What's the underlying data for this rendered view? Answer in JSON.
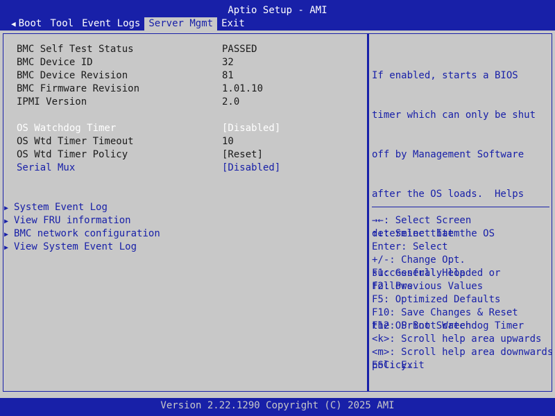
{
  "header": {
    "title": "Aptio Setup - AMI",
    "tabs": [
      {
        "label": "Boot",
        "has_arrow": true
      },
      {
        "label": "Tool"
      },
      {
        "label": "Event Logs"
      },
      {
        "label": "Server Mgmt",
        "active": true
      },
      {
        "label": "Exit"
      }
    ]
  },
  "info": {
    "rows": [
      {
        "label": "BMC Self Test Status",
        "value": "PASSED"
      },
      {
        "label": "BMC Device ID",
        "value": "32"
      },
      {
        "label": "BMC Device Revision",
        "value": "81"
      },
      {
        "label": "BMC Firmware Revision",
        "value": "1.01.10"
      },
      {
        "label": "IPMI Version",
        "value": "2.0"
      }
    ]
  },
  "settings": {
    "rows": [
      {
        "label": "OS Watchdog Timer",
        "value": "[Disabled]"
      },
      {
        "label": "OS Wtd Timer Timeout",
        "value": "10"
      },
      {
        "label": "OS Wtd Timer Policy",
        "value": "[Reset]"
      },
      {
        "label": "Serial Mux",
        "value": "[Disabled]"
      }
    ]
  },
  "submenus": [
    {
      "label": "System Event Log"
    },
    {
      "label": "View FRU information"
    },
    {
      "label": "BMC network configuration"
    },
    {
      "label": "View System Event Log"
    }
  ],
  "help": {
    "lines": [
      "If enabled, starts a BIOS",
      "timer which can only be shut",
      "off by Management Software",
      "after the OS loads.  Helps",
      "determine that the OS",
      "successfully loaded or follows",
      "the OS Boot Watchdog Timer",
      "policy."
    ],
    "keys": [
      "→←: Select Screen",
      "↑↓: Select Item",
      "Enter: Select",
      "+/-: Change Opt.",
      "F1: General Help",
      "F2: Previous Values",
      "F5: Optimized Defaults",
      "F10: Save Changes & Reset",
      "F12: Print Screen",
      "<k>: Scroll help area upwards",
      "<m>: Scroll help area downwards",
      "ESC: Exit"
    ]
  },
  "footer": {
    "text": "Version 2.22.1290 Copyright (C) 2025 AMI"
  },
  "colors": {
    "bios_blue": "#1820a8",
    "panel_gray": "#c8c8c8",
    "text_dark": "#1a1a1a",
    "white": "#ffffff"
  }
}
